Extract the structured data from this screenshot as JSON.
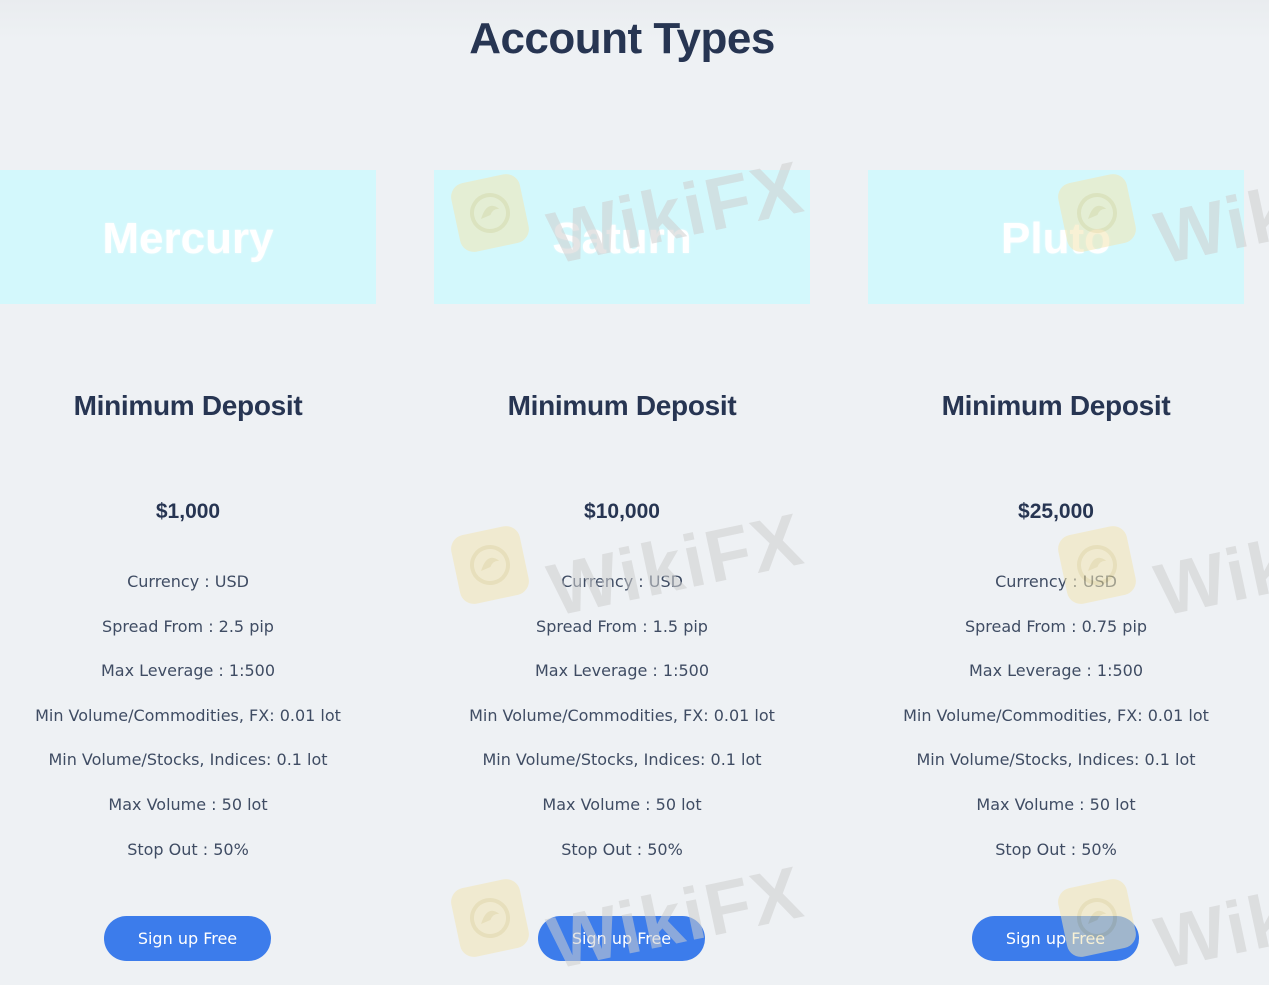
{
  "page": {
    "title": "Account Types"
  },
  "plans": [
    {
      "name": "Mercury",
      "subtitle": "Minimum Deposit",
      "price": "$1,000",
      "features": [
        "Currency : USD",
        "Spread From : 2.5 pip",
        "Max Leverage : 1:500",
        "Min Volume/Commodities, FX: 0.01 lot",
        "Min Volume/Stocks, Indices: 0.1 lot",
        "Max Volume : 50 lot",
        "Stop Out : 50%"
      ],
      "button_label": "Sign up Free"
    },
    {
      "name": "Saturn",
      "subtitle": "Minimum Deposit",
      "price": "$10,000",
      "features": [
        "Currency : USD",
        "Spread From : 1.5 pip",
        "Max Leverage : 1:500",
        "Min Volume/Commodities, FX: 0.01 lot",
        "Min Volume/Stocks, Indices: 0.1 lot",
        "Max Volume : 50 lot",
        "Stop Out : 50%"
      ],
      "button_label": "Sign up Free"
    },
    {
      "name": "Pluto",
      "subtitle": "Minimum Deposit",
      "price": "$25,000",
      "features": [
        "Currency : USD",
        "Spread From : 0.75 pip",
        "Max Leverage : 1:500",
        "Min Volume/Commodities, FX: 0.01 lot",
        "Min Volume/Stocks, Indices: 0.1 lot",
        "Max Volume : 50 lot",
        "Stop Out : 50%"
      ],
      "button_label": "Sign up Free"
    }
  ],
  "watermark": {
    "text": "WikiFX",
    "icon": "wikifx-logo-icon"
  },
  "colors": {
    "background": "#eef1f4",
    "plan_header": "#d3f8fc",
    "heading": "#273552",
    "button": "#3c7ceb"
  }
}
